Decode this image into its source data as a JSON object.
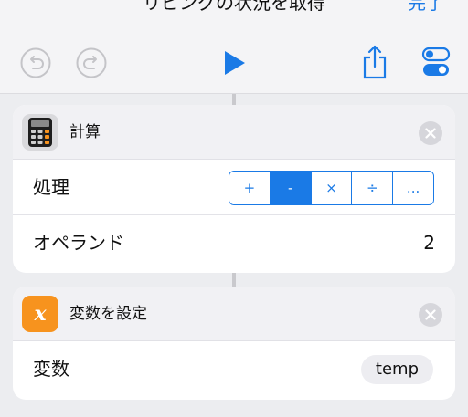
{
  "navbar": {
    "title": "リピングの状況を取得",
    "done_label": "完了",
    "icons": [
      "undo-icon",
      "redo-icon",
      "play-icon",
      "share-icon",
      "settings-toggle-icon"
    ]
  },
  "colors": {
    "accent": "#1a7ae6",
    "calculator_bg": "#d9d9dc",
    "variable_bg": "#f7931e"
  },
  "calculate_card": {
    "title": "計算",
    "icon": "calculator-icon",
    "operation_label": "処理",
    "operations": [
      "+",
      "-",
      "×",
      "÷",
      "..."
    ],
    "selected_operation": "-",
    "operand_label": "オペランド",
    "operand_value": "2"
  },
  "set_variable_card": {
    "title": "変数を設定",
    "icon": "variable-x-icon",
    "variable_label": "変数",
    "variable_value": "temp"
  }
}
